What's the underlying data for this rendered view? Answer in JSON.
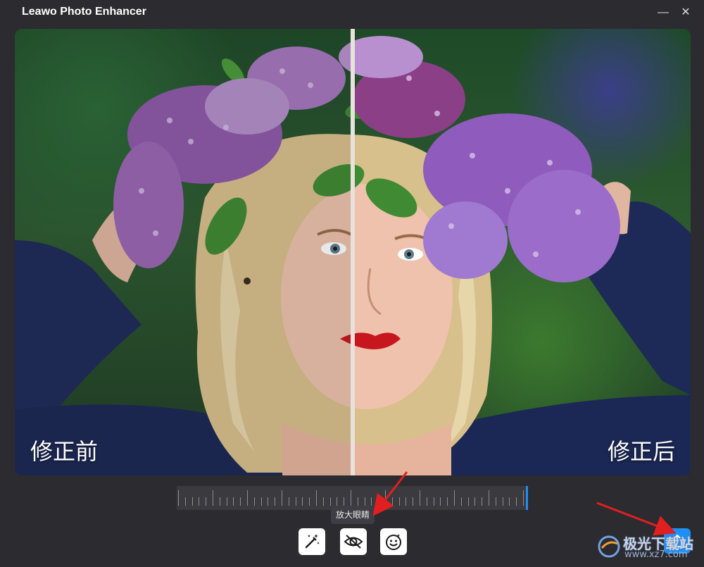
{
  "window": {
    "title": "Leawo Photo Enhancer",
    "minimize_glyph": "—",
    "close_glyph": "✕"
  },
  "preview": {
    "before_label": "修正前",
    "after_label": "修正后"
  },
  "tooltip": {
    "text": "放大眼睛"
  },
  "toolbar": {
    "tools": [
      {
        "icon": "magic-wand-icon"
      },
      {
        "icon": "eye-icon"
      },
      {
        "icon": "face-icon"
      }
    ],
    "export_icon": "export-icon"
  },
  "watermark": {
    "text": "极光下载站",
    "url": "www.xz7.com"
  },
  "colors": {
    "accent": "#1e8ff5",
    "background": "#2b2b30",
    "annotation_arrow": "#e02020"
  }
}
